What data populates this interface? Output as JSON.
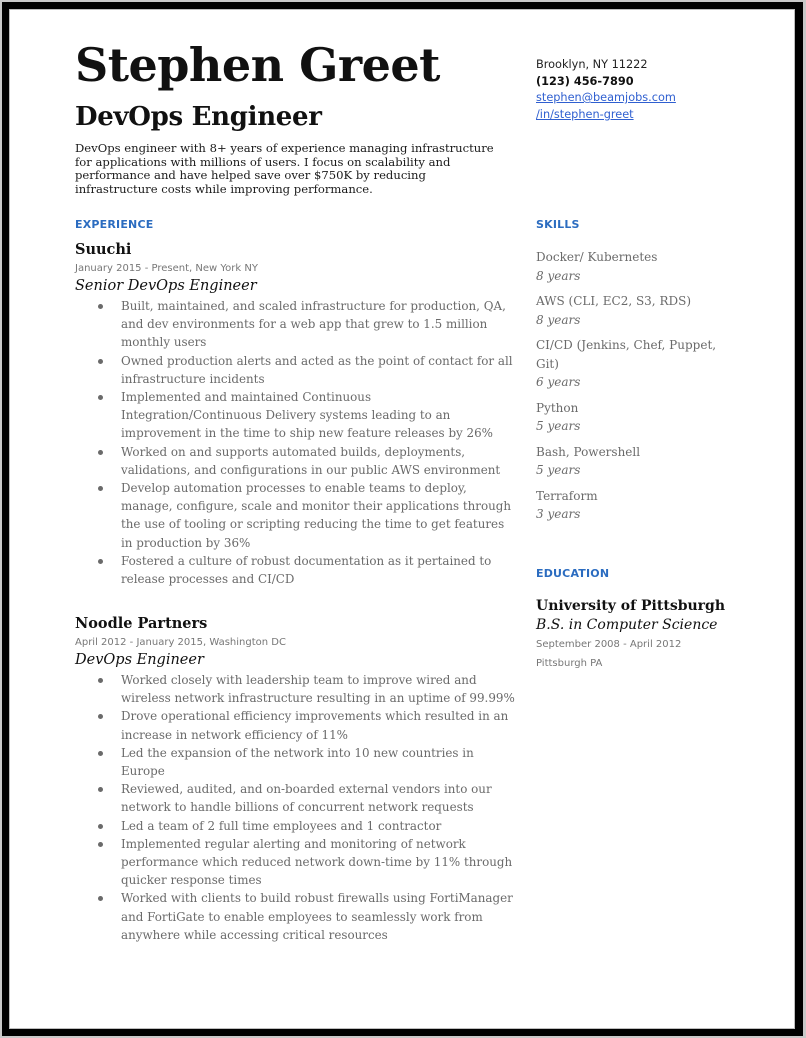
{
  "header": {
    "name": "Stephen Greet",
    "title": "DevOps Engineer",
    "summary": "DevOps engineer with 8+ years of experience managing infrastructure for applications with millions of users. I focus on scalability and performance and have helped save  over $750K by reducing infrastructure costs while improving performance."
  },
  "contact": {
    "location": "Brooklyn, NY 11222",
    "phone": "(123) 456-7890",
    "email": "stephen@beamjobs.com",
    "linkedin": "/in/stephen-greet"
  },
  "experience": {
    "heading": "EXPERIENCE",
    "jobs": [
      {
        "company": "Suuchi",
        "meta": "January 2015 - Present, New York NY",
        "role": "Senior DevOps Engineer",
        "bullets": [
          "Built, maintained, and scaled infrastructure for production, QA, and dev environments for a web app that grew to 1.5 million monthly users",
          "Owned production alerts and acted as the point of contact for all infrastructure incidents",
          "Implemented and maintained Continuous Integration/Continuous Delivery systems leading to an improvement in the time to ship new feature releases by 26%",
          "Worked on and supports automated builds, deployments, validations, and configurations in our public AWS environment",
          "Develop automation processes to enable teams to deploy, manage, configure, scale and monitor their applications through the use of tooling or scripting reducing the time to get features in production by 36%",
          "Fostered a culture of robust documentation as it pertained to release processes and CI/CD"
        ]
      },
      {
        "company": "Noodle Partners",
        "meta": "April 2012 - January 2015, Washington DC",
        "role": "DevOps Engineer",
        "bullets": [
          "Worked closely with leadership team to improve wired and wireless network infrastructure resulting in an uptime of 99.99%",
          "Drove operational efficiency improvements which resulted in an increase in network efficiency of 11%",
          "Led the expansion of the network into 10 new countries in Europe",
          "Reviewed, audited, and on-boarded external vendors into our network to handle billions of concurrent network requests",
          "Led a team of 2 full time employees and 1 contractor",
          "Implemented regular alerting and monitoring of network performance which reduced network down-time by 11% through quicker response times",
          "Worked with clients to build robust firewalls using FortiManager and FortiGate to enable employees to seamlessly work from anywhere while accessing critical resources"
        ]
      }
    ]
  },
  "skills": {
    "heading": "SKILLS",
    "items": [
      {
        "name": "Docker/ Kubernetes",
        "years": "8 years"
      },
      {
        "name": "AWS (CLI, EC2, S3, RDS)",
        "years": "8 years"
      },
      {
        "name": "CI/CD (Jenkins, Chef, Puppet, Git)",
        "years": "6 years"
      },
      {
        "name": "Python",
        "years": "5 years"
      },
      {
        "name": "Bash, Powershell",
        "years": "5 years"
      },
      {
        "name": "Terraform",
        "years": "3 years"
      }
    ]
  },
  "education": {
    "heading": "EDUCATION",
    "school": "University of Pittsburgh",
    "degree": "B.S. in Computer Science",
    "dates": "September 2008 - April 2012",
    "location": "Pittsburgh PA"
  }
}
